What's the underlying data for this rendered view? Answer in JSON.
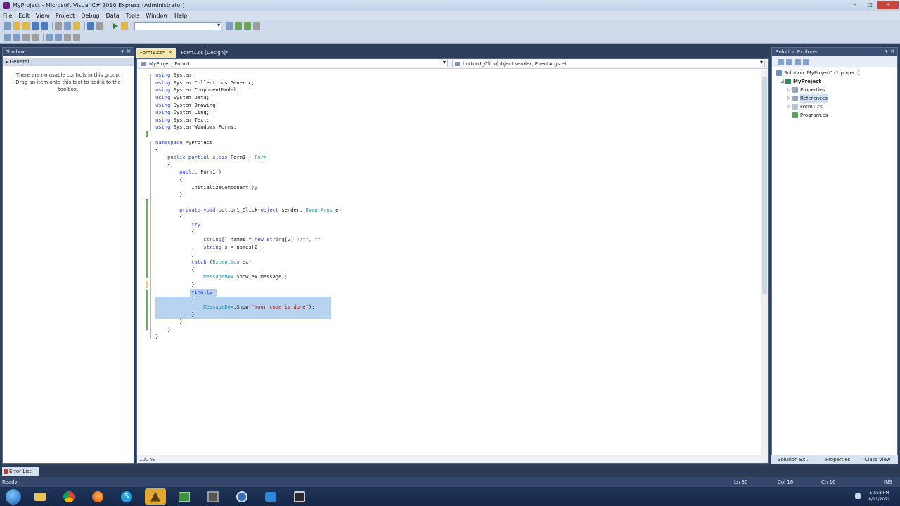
{
  "window": {
    "title": "MyProject - Microsoft Visual C# 2010 Express (Administrator)",
    "controls": [
      "–",
      "□",
      "✕"
    ]
  },
  "menu": [
    "File",
    "Edit",
    "View",
    "Project",
    "Debug",
    "Data",
    "Tools",
    "Window",
    "Help"
  ],
  "toolbox": {
    "title": "Toolbox",
    "group": "General",
    "message": "There are no usable controls in this group. Drag an item onto this text to add it to the toolbox."
  },
  "editor": {
    "tabs": [
      {
        "label": "Form1.cs*",
        "active": true
      },
      {
        "label": "Form1.cs [Design]*",
        "active": false
      }
    ],
    "nav_left": "MyProject.Form1",
    "nav_right": "button1_Click(object sender, EventArgs e)",
    "zoom": "100 %",
    "lines": [
      "using System;",
      "using System.Collections.Generic;",
      "using System.ComponentModel;",
      "using System.Data;",
      "using System.Drawing;",
      "using System.Linq;",
      "using System.Text;",
      "using System.Windows.Forms;",
      "",
      "namespace MyProject",
      "{",
      "    public partial class Form1 : Form",
      "    {",
      "        public Form1()",
      "        {",
      "            InitializeComponent();",
      "        }",
      "",
      "        private void button1_Click(object sender, EventArgs e)",
      "        {",
      "            try",
      "            {",
      "                string[] names = new string[2];//\"\", \"\"",
      "                string s = names[2];",
      "            }",
      "            catch (Exception ex)",
      "            {",
      "                MessageBox.Show(ex.Message);",
      "            }",
      "            finally",
      "            {",
      "                MessageBox.Show(\"Your code is done\");",
      "            }",
      "        }",
      "    }",
      "}"
    ]
  },
  "solution_explorer": {
    "title": "Solution Explorer",
    "items": [
      {
        "label": "Solution 'MyProject' (1 project)",
        "level": 0
      },
      {
        "label": "MyProject",
        "level": 1
      },
      {
        "label": "Properties",
        "level": 2
      },
      {
        "label": "References",
        "level": 2
      },
      {
        "label": "Form1.cs",
        "level": 2
      },
      {
        "label": "Program.cs",
        "level": 2
      }
    ],
    "bottom_tabs": [
      "Solution Ex...",
      "Properties",
      "Class View"
    ]
  },
  "bottom": {
    "error_list": "Error List",
    "status": "Ready",
    "ln": "Ln 30",
    "col": "Col 16",
    "ch": "Ch 16",
    "ins": "INS"
  },
  "taskbar": {
    "clock_time": "10:58 PM",
    "clock_date": "8/11/2012"
  }
}
